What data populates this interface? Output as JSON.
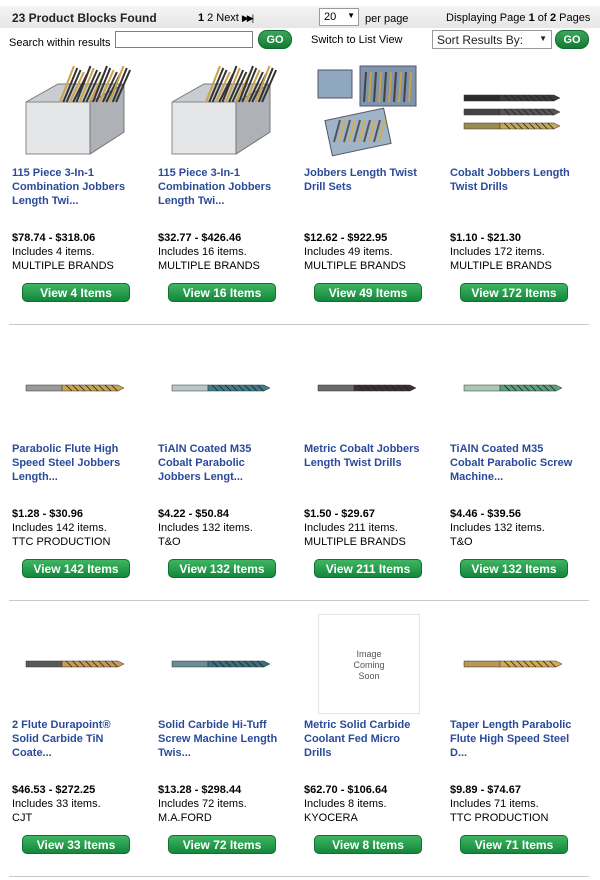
{
  "header": {
    "found": "23 Product Blocks Found",
    "pager": {
      "current": "1",
      "page2": "2",
      "next": "Next",
      "last": "▶▶|"
    },
    "per_page_value": "20",
    "per_page_label": "per page",
    "displaying_prefix": "Displaying Page ",
    "displaying_current": "1",
    "displaying_mid": " of ",
    "displaying_total": "2",
    "displaying_suffix": " Pages"
  },
  "search": {
    "label": "Search within results",
    "value": "",
    "go": "GO",
    "switch": "Switch to List View",
    "sort_label": "Sort Results By:",
    "sort_go": "GO"
  },
  "products": [
    {
      "title_lines": [
        "115 Piece 3-In-1",
        "Combination Jobbers",
        "Length Twi..."
      ],
      "price": "$78.74 - $318.06",
      "includes": "Includes 4 items.",
      "brand": "MULTIPLE BRANDS",
      "button": "View 4 Items",
      "image": "case"
    },
    {
      "title_lines": [
        "115 Piece 3-In-1",
        "Combination Jobbers",
        "Length Twi..."
      ],
      "price": "$32.77 - $426.46",
      "includes": "Includes 16 items.",
      "brand": "MULTIPLE BRANDS",
      "button": "View 16 Items",
      "image": "case"
    },
    {
      "title_lines": [
        "Jobbers Length Twist",
        "Drill Sets"
      ],
      "price": "$12.62 - $922.95",
      "includes": "Includes 49 items.",
      "brand": "MULTIPLE BRANDS",
      "button": "View 49 Items",
      "image": "sets"
    },
    {
      "title_lines": [
        "Cobalt Jobbers Length",
        "Twist Drills"
      ],
      "price": "$1.10 - $21.30",
      "includes": "Includes 172 items.",
      "brand": "MULTIPLE BRANDS",
      "button": "View 172 Items",
      "image": "three-bits"
    },
    {
      "title_lines": [
        "Parabolic Flute High",
        "Speed Steel Jobbers",
        "Length..."
      ],
      "price": "$1.28 - $30.96",
      "includes": "Includes 142 items.",
      "brand": "TTC PRODUCTION",
      "button": "View 142 Items",
      "image": "bit-gold"
    },
    {
      "title_lines": [
        "TiAlN Coated M35",
        "Cobalt Parabolic",
        "Jobbers Lengt..."
      ],
      "price": "$4.22 - $50.84",
      "includes": "Includes 132 items.",
      "brand": "T&O",
      "button": "View 132 Items",
      "image": "bit-teal"
    },
    {
      "title_lines": [
        "Metric Cobalt Jobbers",
        "Length Twist Drills"
      ],
      "price": "$1.50 - $29.67",
      "includes": "Includes 211 items.",
      "brand": "MULTIPLE BRANDS",
      "button": "View 211 Items",
      "image": "bit-dark"
    },
    {
      "title_lines": [
        "TiAlN Coated M35",
        "Cobalt Parabolic Screw",
        "Machine..."
      ],
      "price": "$4.46 - $39.56",
      "includes": "Includes 132 items.",
      "brand": "T&O",
      "button": "View 132 Items",
      "image": "bit-green"
    },
    {
      "title_lines": [
        "2 Flute Durapoint®",
        "Solid Carbide TiN",
        "Coate..."
      ],
      "price": "$46.53 - $272.25",
      "includes": "Includes 33 items.",
      "brand": "CJT",
      "button": "View 33 Items",
      "image": "bit-carbide"
    },
    {
      "title_lines": [
        "Solid Carbide Hi-Tuff",
        "Screw Machine Length",
        "Twis..."
      ],
      "price": "$13.28 - $298.44",
      "includes": "Includes 72 items.",
      "brand": "M.A.FORD",
      "button": "View 72 Items",
      "image": "bit-blue"
    },
    {
      "title_lines": [
        "Metric Solid Carbide",
        "Coolant Fed Micro",
        "Drills"
      ],
      "price": "$62.70 - $106.64",
      "includes": "Includes 8 items.",
      "brand": "KYOCERA",
      "button": "View 8 Items",
      "image": "none",
      "image_text": [
        "Image",
        "Coming",
        "Soon"
      ]
    },
    {
      "title_lines": [
        "Taper Length Parabolic",
        "Flute High Speed Steel",
        "D..."
      ],
      "price": "$9.89 - $74.67",
      "includes": "Includes 71 items.",
      "brand": "TTC PRODUCTION",
      "button": "View 71 Items",
      "image": "bit-gold-long"
    }
  ],
  "colors": {
    "title": "#2a4a9a",
    "button": "#1a8a40"
  }
}
